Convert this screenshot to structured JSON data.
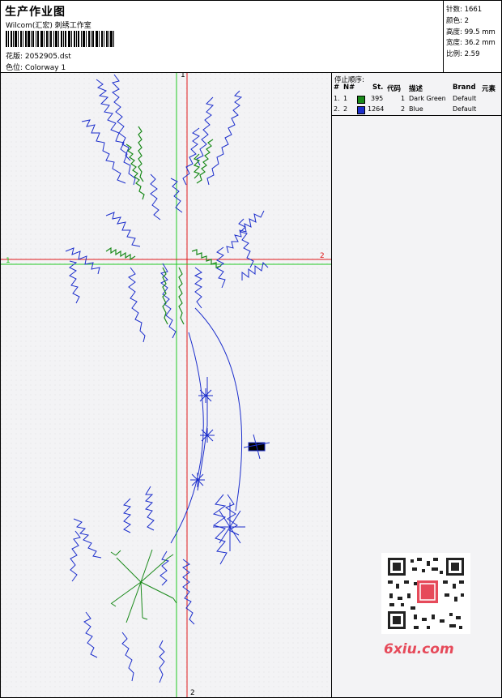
{
  "header": {
    "title": "生产作业图",
    "subtitle": "Wilcom(汇宏) 刺绣工作室",
    "design_label": "花版:",
    "design_file": "2052905.dst",
    "colorway_label": "色位:",
    "colorway": "Colorway 1"
  },
  "stats": {
    "stitches": "针数: 1661",
    "colors": "颜色: 2",
    "height": "高度: 99.5 mm",
    "width": "宽度: 36.2 mm",
    "scale": "比例: 2.59"
  },
  "stop_sequence": {
    "heading": "停止顺序:",
    "columns": [
      "#",
      "N#",
      "St.",
      "代码",
      "描述",
      "Brand",
      "元素"
    ],
    "rows": [
      {
        "seq": "1.",
        "n": "1",
        "color": "#1a8a1a",
        "stitches": "395",
        "code": "1",
        "desc": "Dark Green",
        "brand": "Default"
      },
      {
        "seq": "2.",
        "n": "2",
        "color": "#1c2ecc",
        "stitches": "1264",
        "code": "2",
        "desc": "Blue",
        "brand": "Default"
      }
    ]
  },
  "axes": {
    "h1_left": "1",
    "h1_right": "2",
    "v1_top": "1",
    "v2_bottom": "2"
  },
  "watermark": "6xiu.com",
  "colors": {
    "blue_thread": "#1c2ecc",
    "green_thread": "#1a8a1a",
    "axis_green": "#22c922",
    "axis_red": "#e01a1a"
  }
}
